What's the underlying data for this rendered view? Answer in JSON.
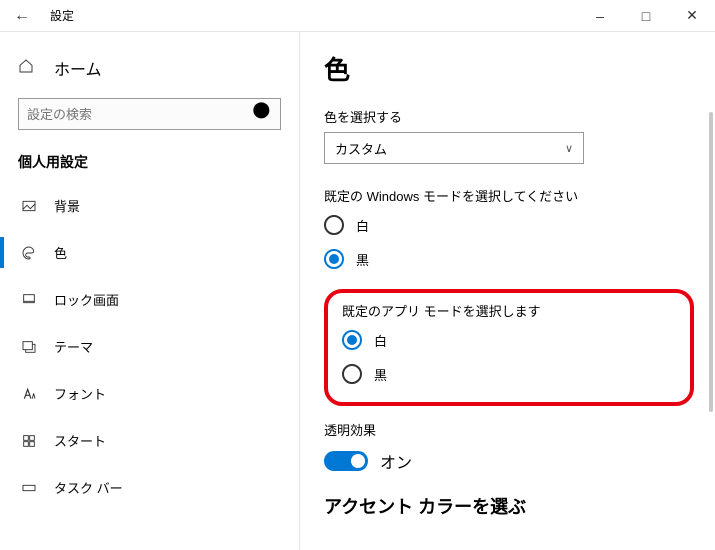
{
  "window": {
    "title": "設定"
  },
  "sidebar": {
    "home_label": "ホーム",
    "search_placeholder": "設定の検索",
    "section_heading": "個人用設定",
    "items": [
      {
        "label": "背景"
      },
      {
        "label": "色"
      },
      {
        "label": "ロック画面"
      },
      {
        "label": "テーマ"
      },
      {
        "label": "フォント"
      },
      {
        "label": "スタート"
      },
      {
        "label": "タスク バー"
      }
    ]
  },
  "main": {
    "heading": "色",
    "picker_label": "色を選択する",
    "picker_value": "カスタム",
    "windows_mode": {
      "label": "既定の Windows モードを選択してください",
      "light": "白",
      "dark": "黒"
    },
    "app_mode": {
      "label": "既定のアプリ モードを選択します",
      "light": "白",
      "dark": "黒"
    },
    "transparency": {
      "label": "透明効果",
      "value": "オン"
    },
    "accent_heading": "アクセント カラーを選ぶ"
  }
}
